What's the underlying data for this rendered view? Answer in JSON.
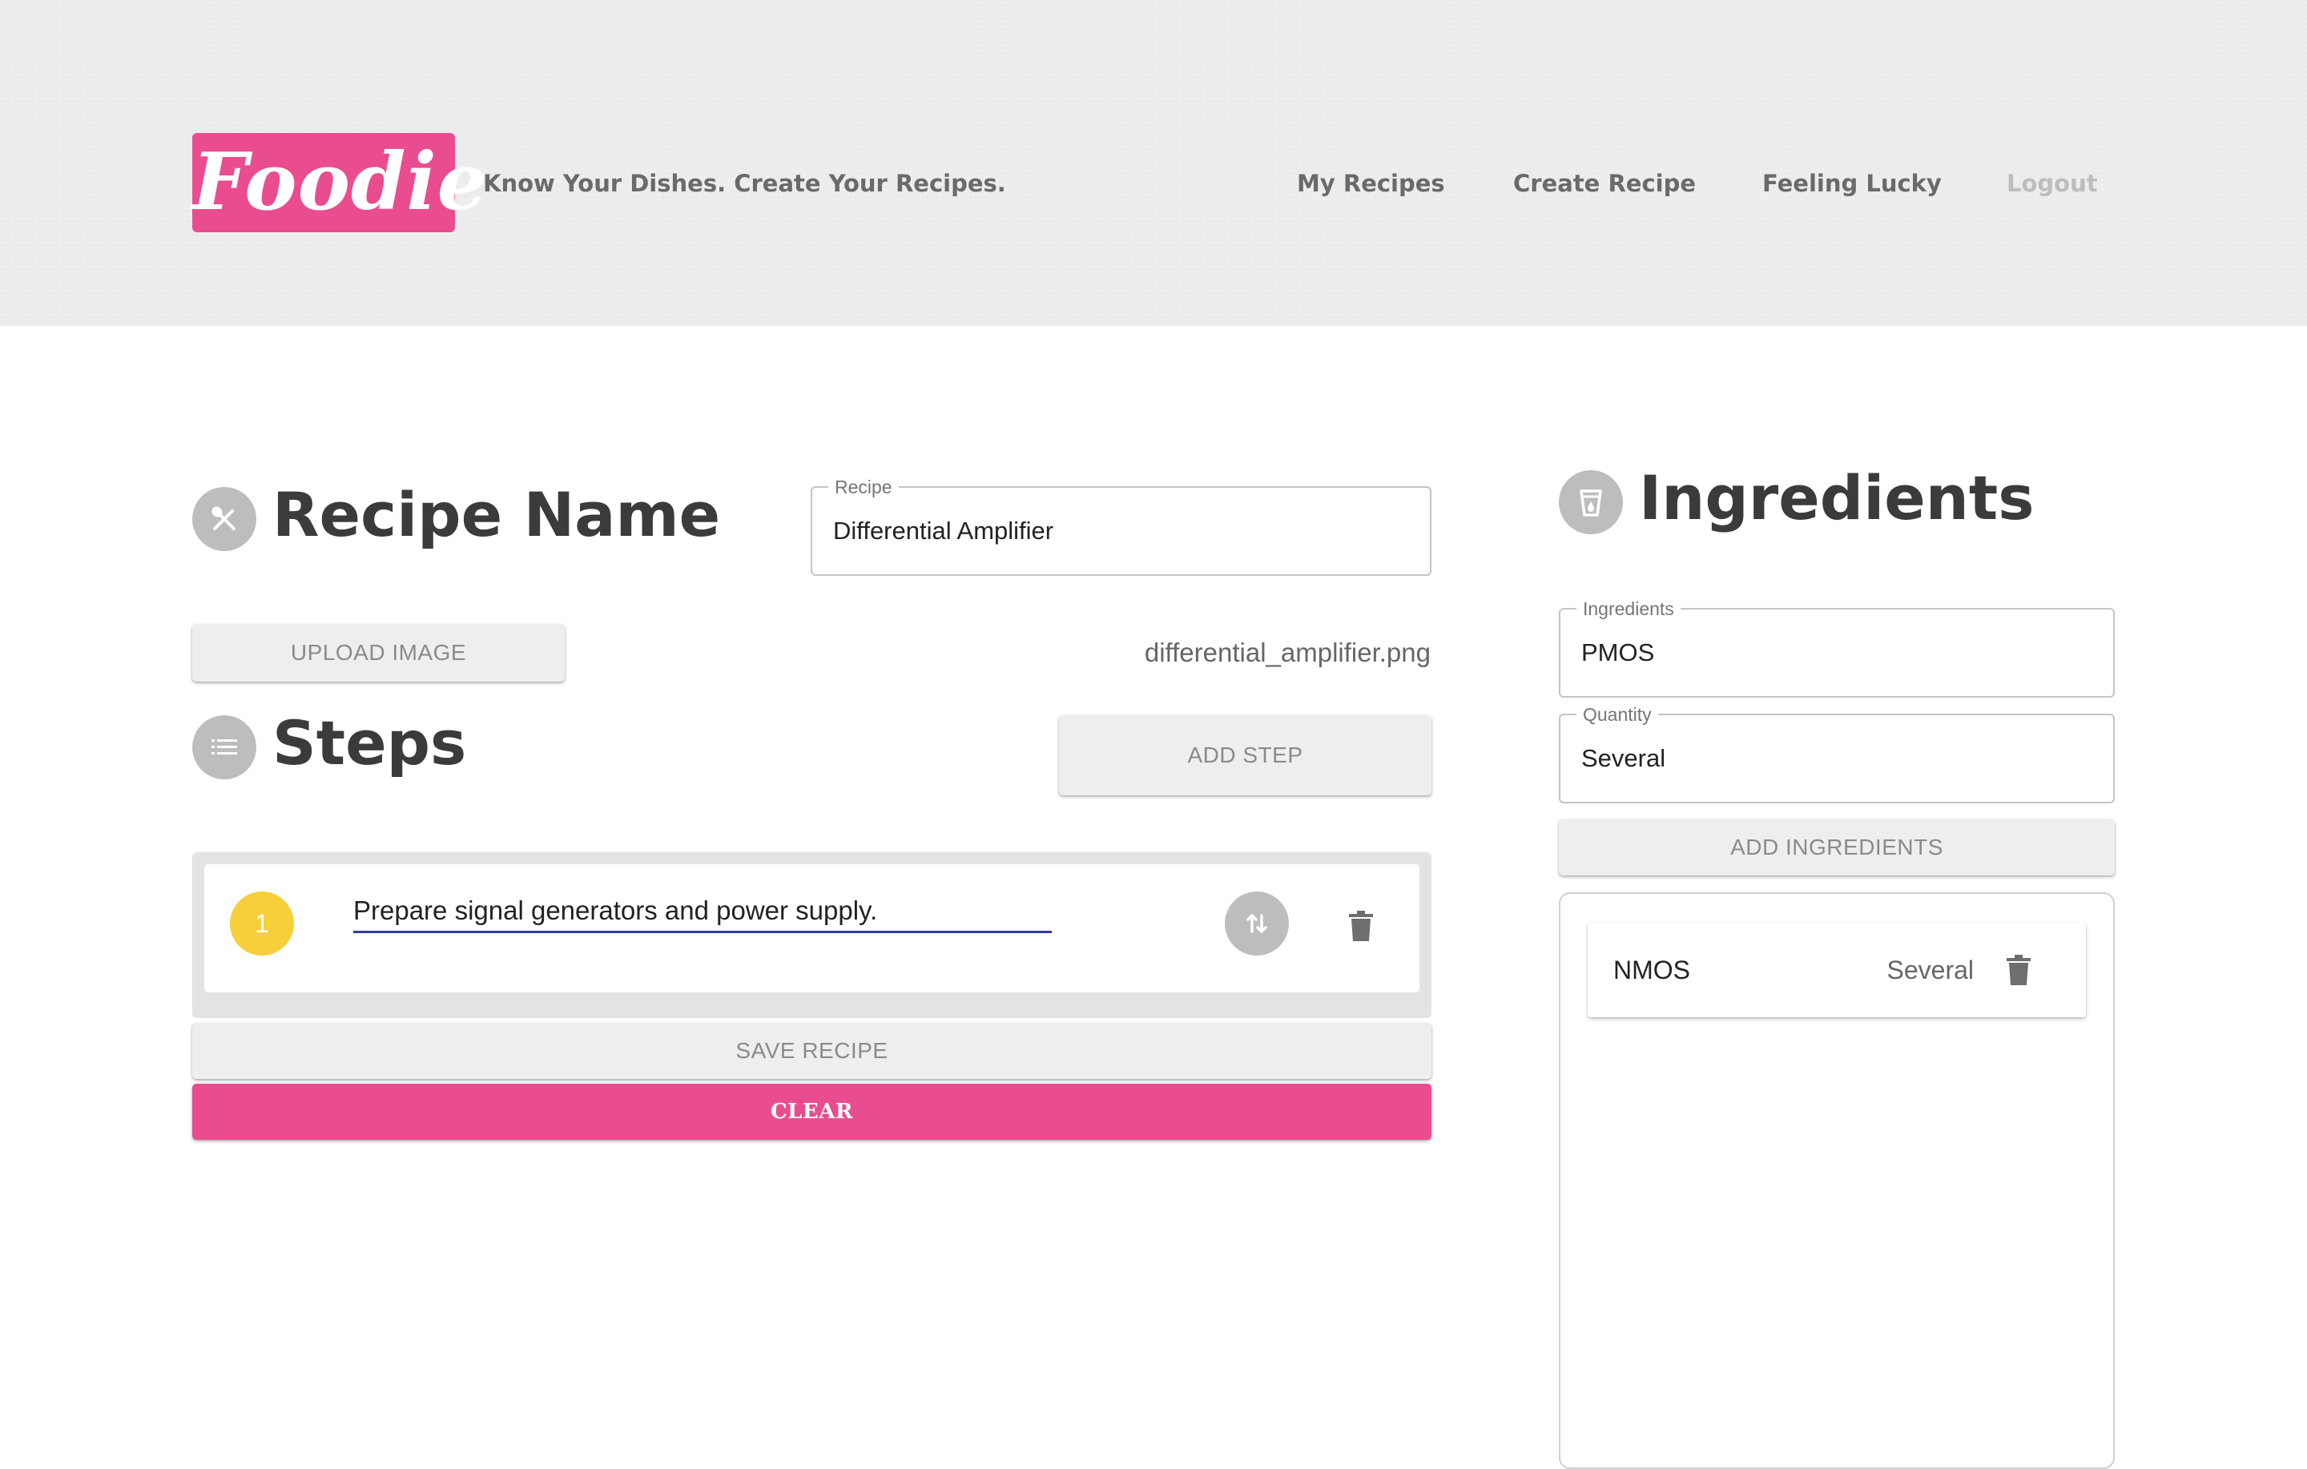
{
  "header": {
    "logo": "Foodie",
    "tagline": "Know Your Dishes. Create Your Recipes.",
    "nav": {
      "my_recipes": "My Recipes",
      "create_recipe": "Create Recipe",
      "feeling_lucky": "Feeling Lucky",
      "logout": "Logout"
    }
  },
  "recipe": {
    "title": "Recipe Name",
    "field_label": "Recipe",
    "field_value": "Differential Amplifier",
    "upload_label": "UPLOAD IMAGE",
    "filename": "differential_amplifier.png"
  },
  "steps": {
    "title": "Steps",
    "add_label": "ADD STEP",
    "items": [
      {
        "number": "1",
        "text": "Prepare signal generators and power supply."
      }
    ]
  },
  "actions": {
    "save_label": "SAVE RECIPE",
    "clear_label": "CLEAR"
  },
  "ingredients": {
    "title": "Ingredients",
    "name_label": "Ingredients",
    "name_value": "PMOS",
    "qty_label": "Quantity",
    "qty_value": "Several",
    "add_label": "ADD INGREDIENTS",
    "items": [
      {
        "name": "NMOS",
        "quantity": "Several"
      }
    ]
  },
  "icons": {
    "recipe": "utensils-icon",
    "steps": "list-icon",
    "ingredients": "cup-icon",
    "reorder": "swap-vertical-icon",
    "delete": "trash-icon"
  },
  "colors": {
    "brand_pink": "#ea4d8f",
    "step_badge": "#f6cf3a",
    "input_underline": "#2f3b9a",
    "icon_gray": "#bdbdbd"
  }
}
